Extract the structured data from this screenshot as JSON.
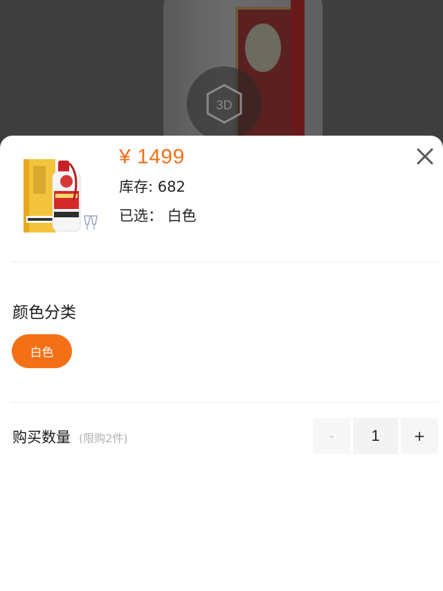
{
  "viewer": {
    "badge_label": "3D"
  },
  "product": {
    "price": "¥ 1499",
    "stock": "库存: 682",
    "selected": "已选：  白色"
  },
  "color_section": {
    "title": "颜色分类",
    "options": [
      {
        "label": "白色",
        "selected": true
      }
    ]
  },
  "quantity_section": {
    "title": "购买数量",
    "limit_note": "(限购2件)",
    "minus_label": "-",
    "value": "1",
    "plus_label": "+"
  },
  "colors": {
    "accent": "#f47016",
    "backdrop": "#3e3e3e"
  },
  "icons": {
    "close": "close-icon",
    "viewer_3d": "3d-cube-icon"
  }
}
